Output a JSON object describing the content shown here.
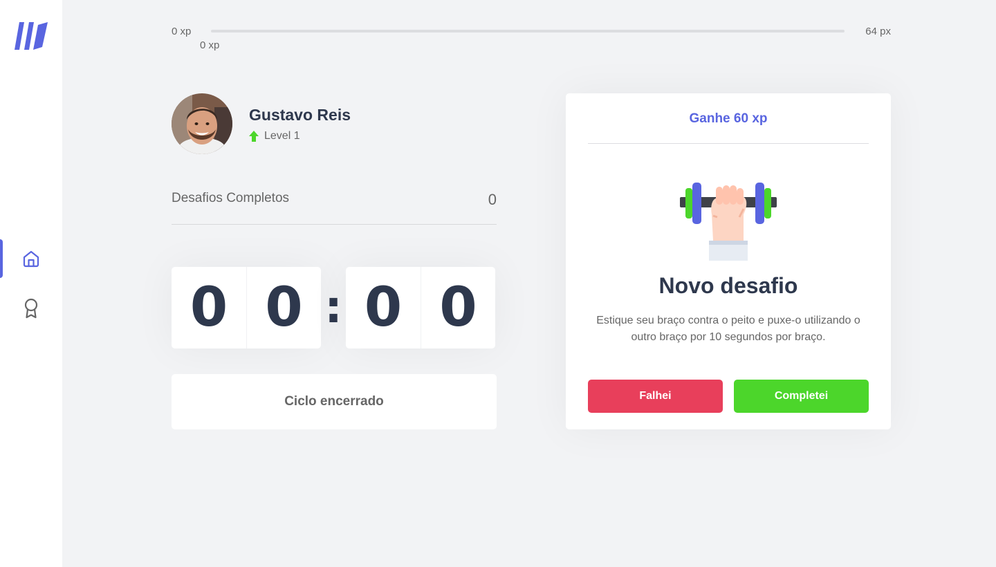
{
  "sidebar": {
    "logo_icon": "logo-icon",
    "items": [
      {
        "icon": "home-icon",
        "active": true
      },
      {
        "icon": "award-icon",
        "active": false
      }
    ],
    "accent_color": "#5965e0"
  },
  "xp_bar": {
    "min_label": "0 xp",
    "max_label": "64 px",
    "current_label": "0 xp",
    "progress_fraction": 0
  },
  "profile": {
    "name": "Gustavo Reis",
    "level_label": "Level 1",
    "level_icon": "level-up-icon"
  },
  "completed_challenges": {
    "label": "Desafios Completos",
    "count": "0"
  },
  "countdown": {
    "minute_left": "0",
    "minute_right": "0",
    "separator": ":",
    "second_left": "0",
    "second_right": "0"
  },
  "cycle_button": {
    "label": "Ciclo encerrado"
  },
  "challenge": {
    "header": "Ganhe 60 xp",
    "illustration": "dumbbell-icon",
    "title": "Novo desafio",
    "description": "Estique seu braço contra o peito e puxe-o utilizando o outro braço por 10 segundos por braço.",
    "fail_label": "Falhei",
    "success_label": "Completei"
  },
  "colors": {
    "primary": "#5965e0",
    "success": "#4cd62b",
    "fail": "#e83f5b",
    "title": "#2e384d",
    "text": "#666666",
    "background": "#f2f3f5"
  }
}
